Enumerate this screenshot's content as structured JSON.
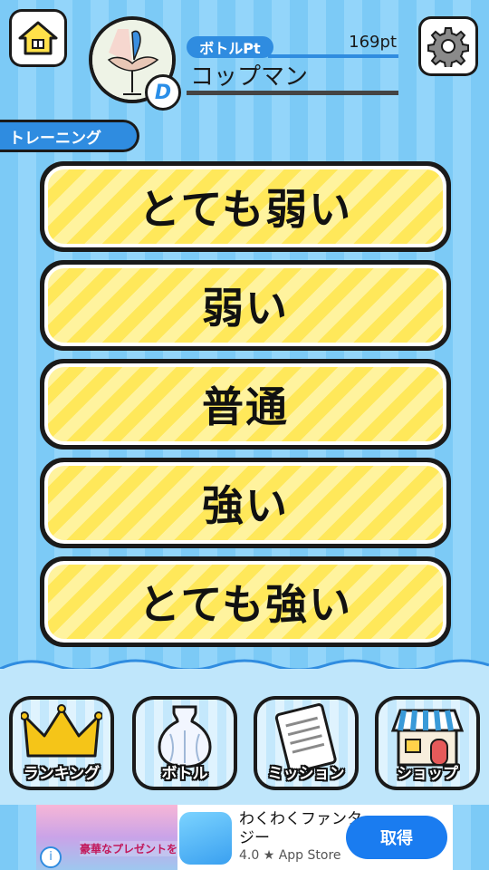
{
  "header": {
    "bottle_pt_label": "ボトルPt",
    "bottle_pt_value": "169pt",
    "player_name": "コップマン",
    "rank_badge": "D"
  },
  "section_tab": {
    "label": "トレーニング"
  },
  "levels": [
    {
      "label": "とても弱い"
    },
    {
      "label": "弱い"
    },
    {
      "label": "普通"
    },
    {
      "label": "強い"
    },
    {
      "label": "とても強い"
    }
  ],
  "bottom_nav": [
    {
      "label": "ランキング",
      "icon": "crown-icon"
    },
    {
      "label": "ボトル",
      "icon": "vase-icon"
    },
    {
      "label": "ミッション",
      "icon": "clipboard-icon"
    },
    {
      "label": "ショップ",
      "icon": "shop-icon"
    }
  ],
  "ad": {
    "app_title": "わくわくファンタジー",
    "rating": "4.0 ★ App Store",
    "cta": "取得",
    "image_text": "豪華なプレゼントを"
  },
  "colors": {
    "accent_blue": "#2f8ce0",
    "button_yellow": "#ffe85a",
    "stripe_blue": "#7ccaf6"
  }
}
